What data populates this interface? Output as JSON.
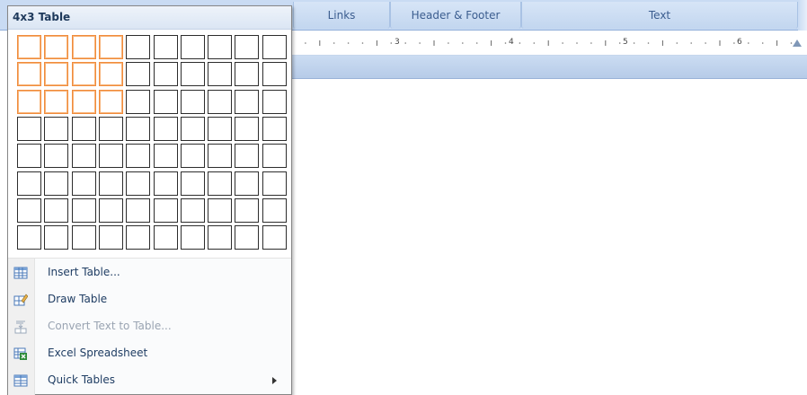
{
  "ribbon": {
    "groups": [
      {
        "label": "Links"
      },
      {
        "label": "Header & Footer"
      },
      {
        "label": "Text"
      }
    ]
  },
  "ruler": {
    "numbers": [
      "3",
      "4",
      "5",
      "6"
    ]
  },
  "menu": {
    "title": "4x3 Table",
    "grid": {
      "columns": 10,
      "rows": 8,
      "selected_columns": 4,
      "selected_rows": 3
    },
    "items": [
      {
        "label": "Insert Table...",
        "icon": "insert-table-icon",
        "enabled": true,
        "has_submenu": false
      },
      {
        "label": "Draw Table",
        "icon": "draw-table-icon",
        "enabled": true,
        "has_submenu": false
      },
      {
        "label": "Convert Text to Table...",
        "icon": "convert-text-icon",
        "enabled": false,
        "has_submenu": false
      },
      {
        "label": "Excel Spreadsheet",
        "icon": "excel-spreadsheet-icon",
        "enabled": true,
        "has_submenu": false
      },
      {
        "label": "Quick Tables",
        "icon": "quick-tables-icon",
        "enabled": true,
        "has_submenu": true
      }
    ]
  },
  "colors": {
    "selection_border": "#f08c3c",
    "ribbon_bg": "#c9dbf3",
    "menu_text": "#1f3d63"
  }
}
